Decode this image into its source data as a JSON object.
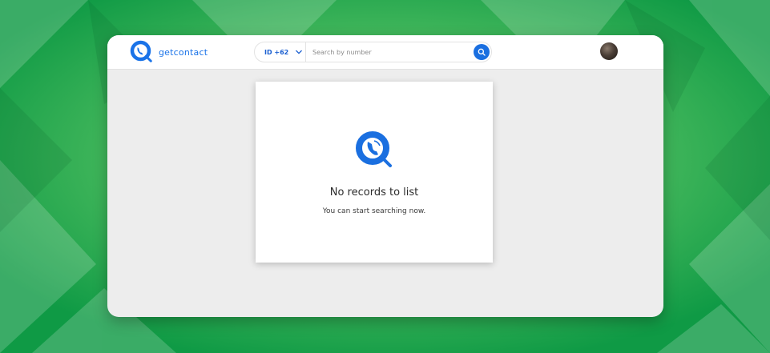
{
  "app": {
    "brand_name": "getcontact",
    "brand_color": "#1a73e8"
  },
  "search": {
    "country_code": "ID +62",
    "placeholder": "Search by number",
    "value": ""
  },
  "empty_state": {
    "title": "No records to list",
    "subtitle": "You can start searching now."
  },
  "icons": {
    "logo": "phone-magnifier-icon",
    "dropdown": "chevron-down-icon",
    "search": "search-icon",
    "avatar": "user-avatar"
  },
  "colors": {
    "accent": "#1a6fe0",
    "background_green": "#22a94f",
    "panel": "#ededed"
  }
}
